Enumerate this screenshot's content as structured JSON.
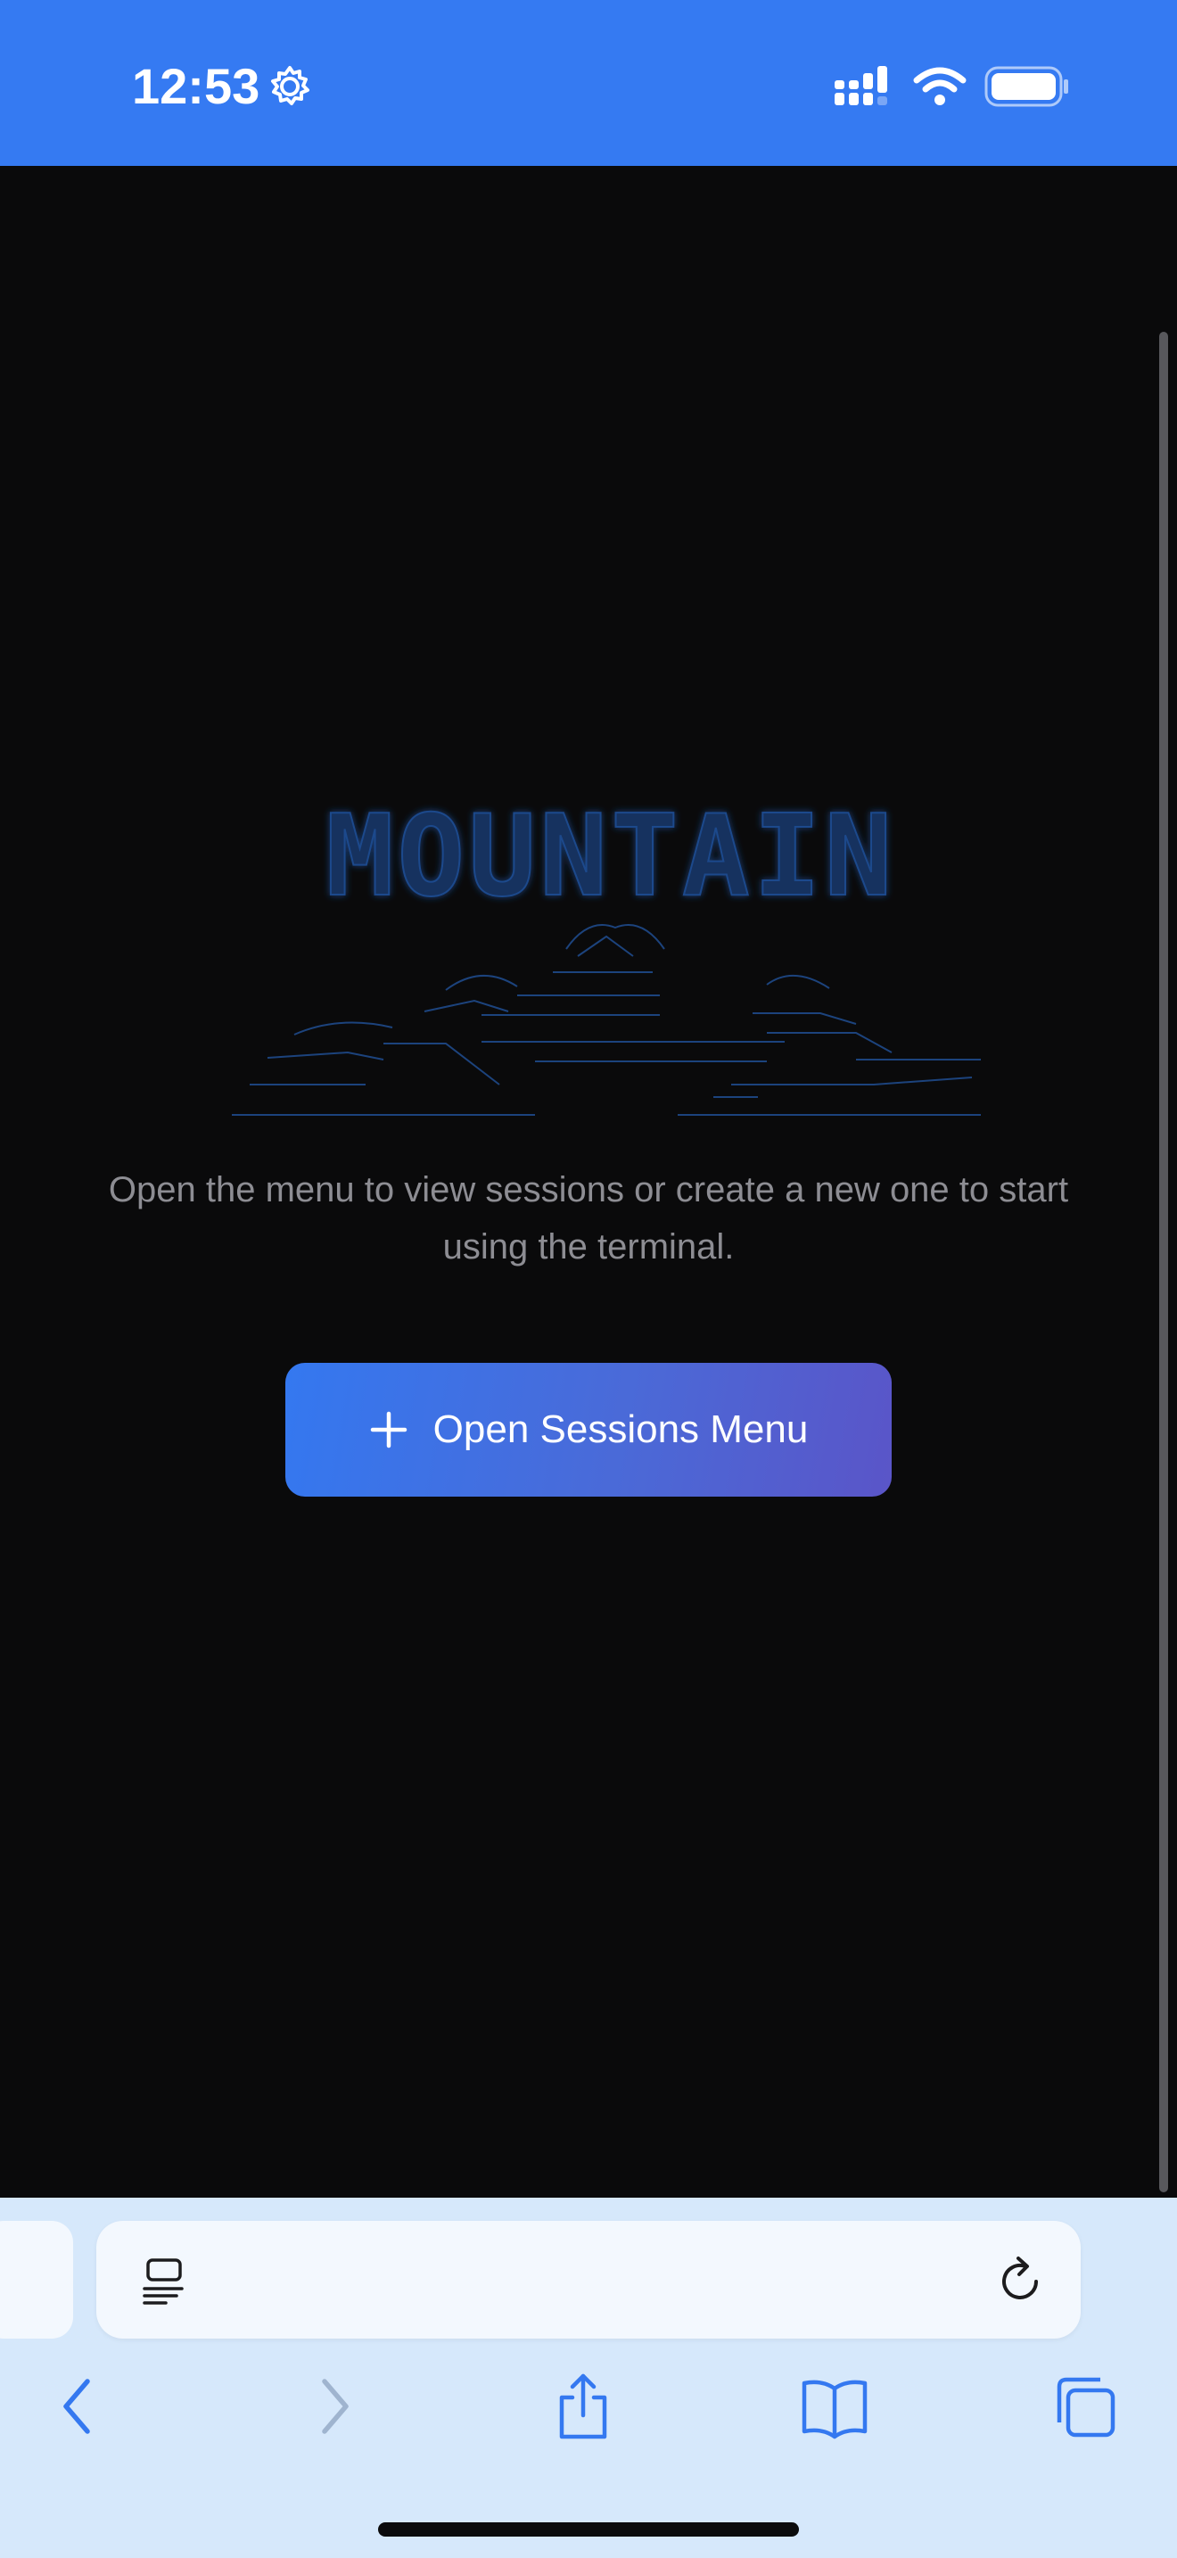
{
  "status_bar": {
    "time": "12:53",
    "background": "#357af2",
    "icons": [
      "settings-gear-icon",
      "cellular-signal-icon",
      "wifi-icon",
      "battery-icon"
    ]
  },
  "main": {
    "logo_text": "MOUNTAIN",
    "empty_message": "Open the menu to view sessions or create a new one to start using the terminal.",
    "open_sessions_button": {
      "label": "Open Sessions Menu",
      "icon": "plus-icon"
    },
    "background": "#0a0a0b",
    "accent": "#3478f0"
  },
  "browser": {
    "background": "#d6e8fb",
    "address_bar_icons": [
      "reader-icon",
      "reload-icon"
    ],
    "toolbar_icons": [
      "back-icon",
      "forward-icon",
      "share-icon",
      "bookmarks-icon",
      "tabs-icon"
    ]
  }
}
